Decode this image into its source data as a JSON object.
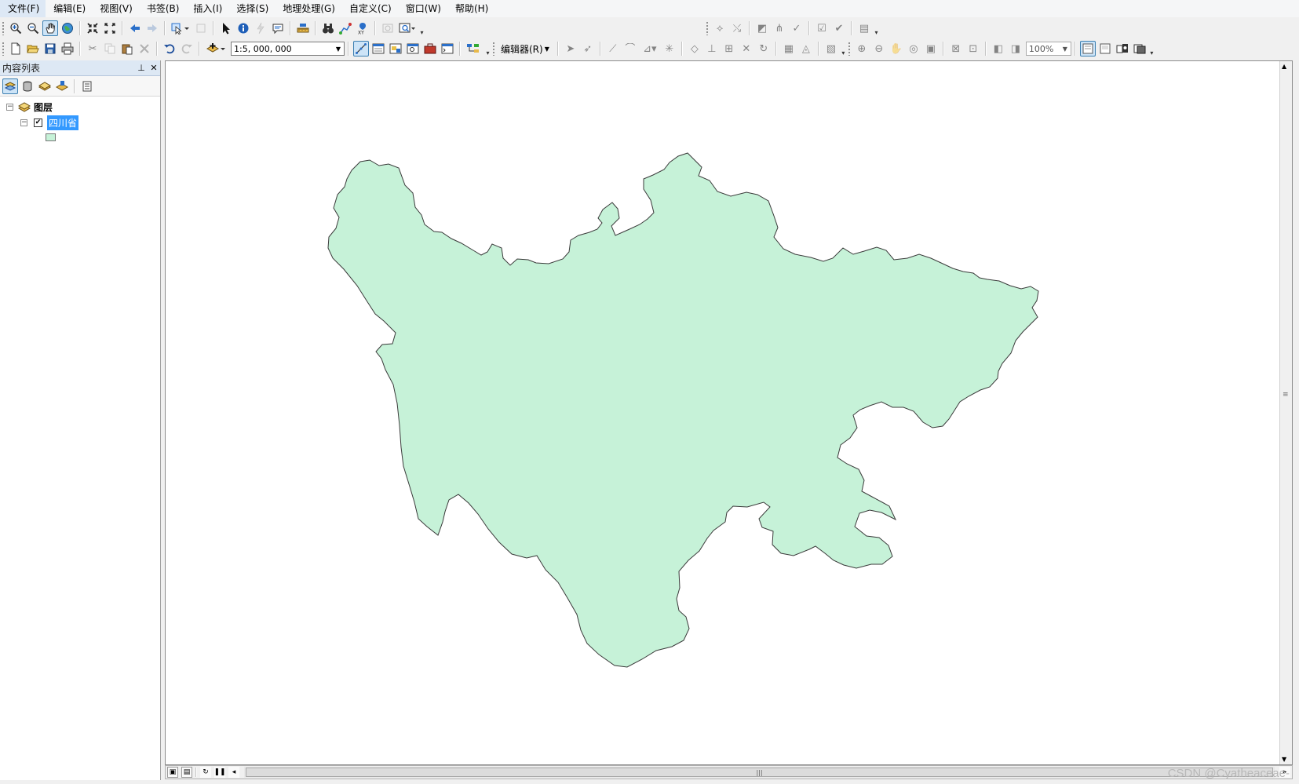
{
  "menu": [
    "文件(F)",
    "编辑(E)",
    "视图(V)",
    "书签(B)",
    "插入(I)",
    "选择(S)",
    "地理处理(G)",
    "自定义(C)",
    "窗口(W)",
    "帮助(H)"
  ],
  "toolbar2": {
    "scale_value": "1:5, 000, 000",
    "editor_label": "编辑器(R)",
    "zoom_value": "100%"
  },
  "toc": {
    "title": "内容列表",
    "group_label": "图层",
    "layer_label": "四川省",
    "layer_checked": true
  },
  "map": {
    "fill_color": "#c6f2d8",
    "outline_color": "#3a3a3a"
  },
  "watermark": "CSDN @Cyatheaceae-"
}
